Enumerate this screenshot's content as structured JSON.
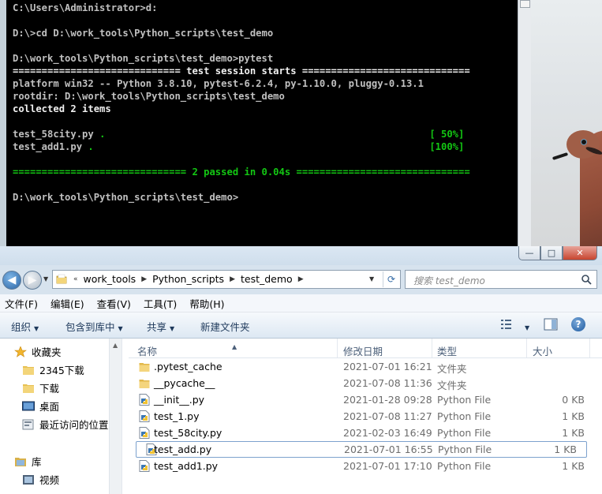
{
  "console": {
    "lines": [
      {
        "text": "C:\\Users\\Administrator>d:",
        "color": "gray"
      },
      {
        "text": "",
        "color": "gray"
      },
      {
        "text": "D:\\>cd D:\\work_tools\\Python_scripts\\test_demo",
        "color": "gray"
      },
      {
        "text": "",
        "color": "gray"
      },
      {
        "text": "D:\\work_tools\\Python_scripts\\test_demo>pytest",
        "color": "gray"
      },
      {
        "text": "============================= test session starts =============================",
        "color": "white"
      },
      {
        "text": "platform win32 -- Python 3.8.10, pytest-6.2.4, py-1.10.0, pluggy-0.13.1",
        "color": "gray"
      },
      {
        "text": "rootdir: D:\\work_tools\\Python_scripts\\test_demo",
        "color": "gray"
      },
      {
        "text": "collected 2 items",
        "color": "white"
      },
      {
        "text": "",
        "color": "gray"
      },
      {
        "text": "test_58city.py . ",
        "suffix": "[ 50%]",
        "color": "gray"
      },
      {
        "text": "test_add1.py . ",
        "suffix": "[100%]",
        "color": "gray"
      },
      {
        "text": "",
        "color": "gray"
      },
      {
        "text": "============================== 2 passed in 0.04s ==============================",
        "color": "green"
      },
      {
        "text": "",
        "color": "gray"
      },
      {
        "text": "D:\\work_tools\\Python_scripts\\test_demo>",
        "color": "gray"
      }
    ]
  },
  "explorer": {
    "window_buttons": {
      "minimize": "—",
      "maximize": "□",
      "close": "✕"
    },
    "breadcrumb": {
      "prefix": "«",
      "parts": [
        "work_tools",
        "Python_scripts",
        "test_demo"
      ]
    },
    "search": {
      "placeholder": "搜索 test_demo"
    },
    "menu": [
      "文件(F)",
      "编辑(E)",
      "查看(V)",
      "工具(T)",
      "帮助(H)"
    ],
    "toolbar": {
      "organize": "组织",
      "include_library": "包含到库中",
      "share": "共享",
      "new_folder": "新建文件夹"
    },
    "nav": [
      {
        "label": "收藏夹",
        "icon": "star-icon"
      },
      {
        "label": "2345下载",
        "icon": "folder-icon"
      },
      {
        "label": "下载",
        "icon": "folder-icon"
      },
      {
        "label": "桌面",
        "icon": "desktop-icon"
      },
      {
        "label": "最近访问的位置",
        "icon": "recent-places-icon"
      },
      {
        "label": "库",
        "icon": "library-icon"
      },
      {
        "label": "视频",
        "icon": "video-icon"
      }
    ],
    "columns": {
      "name": "名称",
      "modified": "修改日期",
      "type": "类型",
      "size": "大小"
    },
    "files": [
      {
        "name": ".pytest_cache",
        "date": "2021-07-01 16:21",
        "type": "文件夹",
        "size": "",
        "kind": "folder"
      },
      {
        "name": "__pycache__",
        "date": "2021-07-08 11:36",
        "type": "文件夹",
        "size": "",
        "kind": "folder"
      },
      {
        "name": "__init__.py",
        "date": "2021-01-28 09:28",
        "type": "Python File",
        "size": "0 KB",
        "kind": "py"
      },
      {
        "name": "test_1.py",
        "date": "2021-07-08 11:27",
        "type": "Python File",
        "size": "1 KB",
        "kind": "py"
      },
      {
        "name": "test_58city.py",
        "date": "2021-02-03 16:49",
        "type": "Python File",
        "size": "1 KB",
        "kind": "py"
      },
      {
        "name": "test_add.py",
        "date": "2021-07-01 16:55",
        "type": "Python File",
        "size": "1 KB",
        "kind": "py",
        "selected": true
      },
      {
        "name": "test_add1.py",
        "date": "2021-07-01 17:10",
        "type": "Python File",
        "size": "1 KB",
        "kind": "py"
      }
    ]
  }
}
